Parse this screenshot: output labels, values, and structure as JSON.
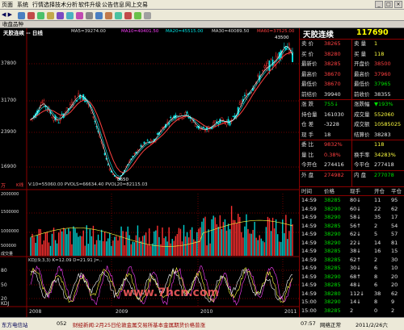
{
  "menu": [
    "页面",
    "系统",
    "行情选择",
    "技术分析",
    "软件升级",
    "公告信息",
    "网上交易"
  ],
  "window_buttons": [
    "_",
    "□",
    "×"
  ],
  "tab_label": "收盘品种",
  "chart": {
    "title": "天胶连续 -- 日线",
    "ma": [
      {
        "text": "MA5=39274.00",
        "color": "#ffffff"
      },
      {
        "text": "MA10=40401.50",
        "color": "#ff40ff"
      },
      {
        "text": "MA20=45515.00",
        "color": "#00e0e0"
      },
      {
        "text": "MA30=40089.50",
        "color": "#ffffff"
      },
      {
        "text": "MA60=37525.00",
        "color": "#ff4040"
      }
    ],
    "price_ticks": [
      "37800",
      "31700",
      "23900",
      "16900",
      "万"
    ],
    "high_label": "43500",
    "low_label": "8650",
    "vol_info": "V:10=55060.00  PVOLS=66634.40  PVOL20=82115.03",
    "vol_ticks": [
      "2000000",
      "1500000",
      "1000000",
      "500000",
      "成交量"
    ],
    "kdj_info": "KDJ(9,3,3)  K=12.09  D=21.91  J=..",
    "kdj_ticks": [
      "80",
      "50",
      "20",
      "KDJ"
    ],
    "years": [
      "2008",
      "2009",
      "2010",
      "2011"
    ],
    "k_left_label": "K线"
  },
  "chart_data": {
    "type": "line",
    "title": "天胶连续 -- 日线",
    "series": [
      {
        "name": "收盘",
        "values": [
          23900,
          25400,
          28500,
          27000,
          24700,
          23500,
          25500,
          27000,
          29300,
          30500,
          29000,
          26200,
          21400,
          16900,
          11900,
          9400,
          8650,
          11500,
          13800,
          15500,
          17200,
          18300,
          18000,
          20600,
          22200,
          23900,
          25000,
          24800,
          25400,
          23900,
          22100,
          21300,
          21600,
          22800,
          23900,
          23400,
          23300,
          25400,
          28900,
          30500,
          32600,
          34800,
          36900,
          38000,
          39200,
          41400,
          43500,
          40000
        ]
      }
    ],
    "ylim": [
      7000,
      45000
    ],
    "x_labels": [
      "2008",
      "2009",
      "2010",
      "2011"
    ]
  },
  "quote": {
    "name": "天胶连续",
    "code": "117690",
    "rows": [
      {
        "l": "卖 价",
        "v": "38265",
        "c": "red",
        "l2": "卖 量",
        "v2": "1",
        "c2": "yel"
      },
      {
        "l": "买 价",
        "v": "38280",
        "c": "red",
        "l2": "买 量",
        "v2": "118",
        "c2": "yel"
      },
      {
        "l": "最新价",
        "v": "38285",
        "c": "red",
        "l2": "开盘价",
        "v2": "38500",
        "c2": "red"
      },
      {
        "l": "最高价",
        "v": "38670",
        "c": "red",
        "l2": "最高价",
        "v2": "37960",
        "c2": "red"
      },
      {
        "l": "最低价",
        "v": "38670",
        "c": "red",
        "l2": "最低价",
        "v2": "37965",
        "c2": "grn"
      },
      {
        "l": "前结价",
        "v": "39940",
        "c": "wht",
        "l2": "前收价",
        "v2": "38355",
        "c2": "wht"
      },
      {
        "l": "涨 跌",
        "v": "755↓",
        "c": "grn",
        "l2": "涨跌幅",
        "v2": "▼193%",
        "c2": "grn"
      },
      {
        "l": "持仓量",
        "v": "161030",
        "c": "wht",
        "l2": "成交量",
        "v2": "552060",
        "c2": "yel"
      },
      {
        "l": "仓 差",
        "v": "-3228",
        "c": "wht",
        "l2": "成交额",
        "v2": "10585025",
        "c2": "yel"
      },
      {
        "l": "现 手",
        "v": "18",
        "c": "wht",
        "l2": "结算价",
        "v2": "38283",
        "c2": "wht"
      },
      {
        "l": "委 比",
        "v": "9832%",
        "c": "red",
        "l2": "",
        "v2": "118",
        "c2": "yel"
      },
      {
        "l": "量 比",
        "v": "0.38%",
        "c": "red",
        "l2": "换手率",
        "v2": "34283%",
        "c2": "yel"
      },
      {
        "l": "今开仓",
        "v": "274416",
        "c": "wht",
        "l2": "今平仓",
        "v2": "277418",
        "c2": "wht"
      },
      {
        "l": "外 盘",
        "v": "274982",
        "c": "red",
        "l2": "内 盘",
        "v2": "277078",
        "c2": "grn"
      }
    ]
  },
  "ticks_header": [
    "时间",
    "价格",
    "现手",
    "开仓",
    "平仓"
  ],
  "ticks": [
    [
      "14:59",
      "38285",
      "80↓",
      "11",
      "95"
    ],
    [
      "14:59",
      "38290",
      "60↓",
      "22",
      "62"
    ],
    [
      "14:59",
      "38290",
      "58↓",
      "35",
      "17"
    ],
    [
      "14:59",
      "38285",
      "56↑",
      "2",
      "54"
    ],
    [
      "14:59",
      "38290",
      "62↓",
      "5",
      "57"
    ],
    [
      "14:59",
      "38290",
      "22↓",
      "14",
      "81"
    ],
    [
      "14:59",
      "38285",
      "38↓",
      "16",
      "15"
    ],
    [
      "14:59",
      "38285",
      "62↑",
      "2",
      "30"
    ],
    [
      "14:59",
      "38285",
      "30↓",
      "6",
      "10"
    ],
    [
      "14:59",
      "38290",
      "68↑",
      "8",
      "20"
    ],
    [
      "14:59",
      "38285",
      "48↓",
      "6",
      "20"
    ],
    [
      "14:59",
      "38280",
      "112↓",
      "38",
      "62"
    ],
    [
      "15:00",
      "38290",
      "14↓",
      "8",
      "9"
    ],
    [
      "15:00",
      "38285",
      "2",
      "0",
      "2"
    ]
  ],
  "statusbar": {
    "app": "东方电信站",
    "code": "052",
    "news": "财经新闻:2月25日伦敦金属交易所基本金属期货价格普涨",
    "time": "07:57",
    "status": "网络正常",
    "date": "2011/2/26六"
  },
  "watermark": "www.7hcn.com"
}
